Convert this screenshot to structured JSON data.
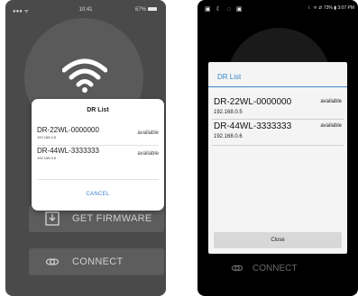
{
  "left_screen": {
    "status_bar": {
      "left": "●●● ᯤ",
      "time": "10:41",
      "battery": "67%"
    },
    "dialog": {
      "title": "DR List",
      "items": [
        {
          "name": "DR-22WL-0000000",
          "ip": "192.168.0.5",
          "status": "available"
        },
        {
          "name": "DR-44WL-3333333",
          "ip": "192.168.0.6",
          "status": "available"
        }
      ],
      "cancel_label": "CANCEL"
    },
    "get_firmware_label": "GET FIRMWARE",
    "connect_label": "CONNECT"
  },
  "right_screen": {
    "status_bar": {
      "left": "▣ ☾ ◌ ▣",
      "right": "☾ ᯤ ⇵ 73% ▮ 3:07 PM"
    },
    "dialog": {
      "title": "DR List",
      "items": [
        {
          "name": "DR-22WL-0000000",
          "ip": "192.168.0.5",
          "status": "available"
        },
        {
          "name": "DR-44WL-3333333",
          "ip": "192.168.0.6",
          "status": "available"
        }
      ],
      "close_label": "Close"
    },
    "connect_label": "CONNECT"
  },
  "colors": {
    "ios_link": "#3a7fd0",
    "android_accent": "#3a86c8"
  }
}
